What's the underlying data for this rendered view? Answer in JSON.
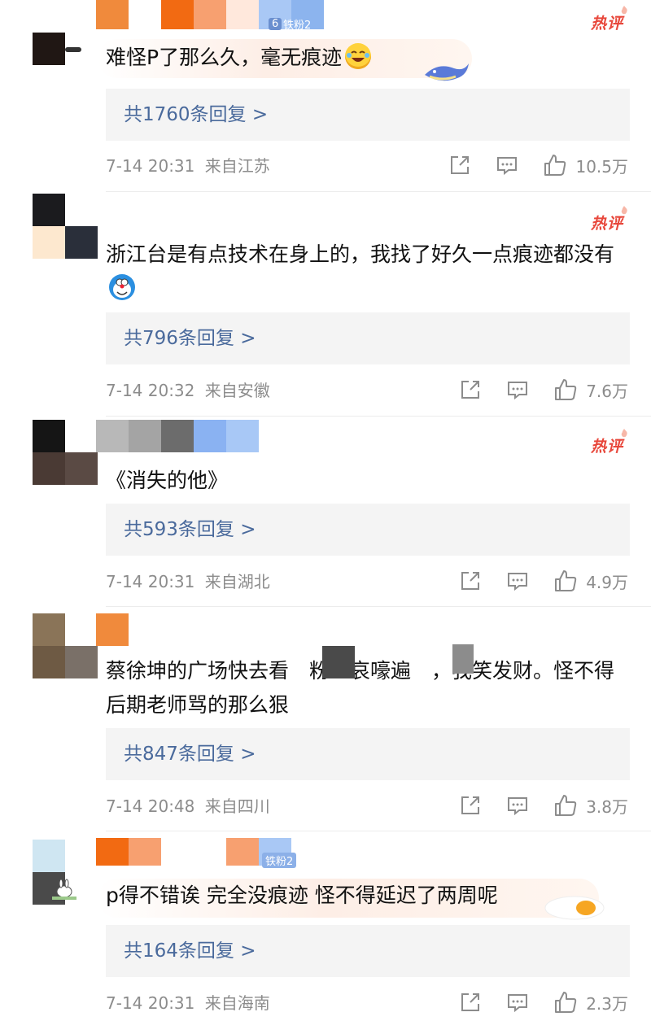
{
  "hot_badge": "热评",
  "reply_suffix_arrow": ">",
  "comments": [
    {
      "text": "难怪P了那么久，毫无痕迹",
      "emoji": "laugh-cry-emoji",
      "replies_label": "共1760条回复 >",
      "timestamp": "7-14 20:31",
      "location": "来自江苏",
      "likes": "10.5万",
      "hot": true,
      "name_fragment": "6",
      "badge_text": "铁粉2"
    },
    {
      "text": "浙江台是有点技术在身上的，我找了好久一点痕迹都没有",
      "emoji": "doraemon-emoji",
      "replies_label": "共796条回复 >",
      "timestamp": "7-14 20:32",
      "location": "来自安徽",
      "likes": "7.6万",
      "hot": true
    },
    {
      "text": "《消失的他》",
      "emoji": "",
      "replies_label": "共593条回复 >",
      "timestamp": "7-14 20:31",
      "location": "来自湖北",
      "likes": "4.9万",
      "hot": true
    },
    {
      "text": "蔡徐坤的广场快去看　粉丝哀嚎遍　，我笑发财。怪不得后期老师骂的那么狠",
      "emoji": "",
      "replies_label": "共847条回复 >",
      "timestamp": "7-14 20:48",
      "location": "来自四川",
      "likes": "3.8万",
      "hot": false
    },
    {
      "text": "p得不错诶 完全没痕迹 怪不得延迟了两周呢",
      "emoji": "",
      "replies_label": "共164条回复 >",
      "timestamp": "7-14 20:31",
      "location": "来自海南",
      "likes": "2.3万",
      "hot": false,
      "badge_text": "铁粉2"
    }
  ],
  "colors": {
    "reply_link": "#4a6a9c",
    "hot_badge": "#e8473b",
    "meta_text": "#8c8c8c",
    "reply_bg": "#f4f4f4"
  },
  "icons": [
    "share-icon",
    "comment-icon",
    "like-icon"
  ]
}
